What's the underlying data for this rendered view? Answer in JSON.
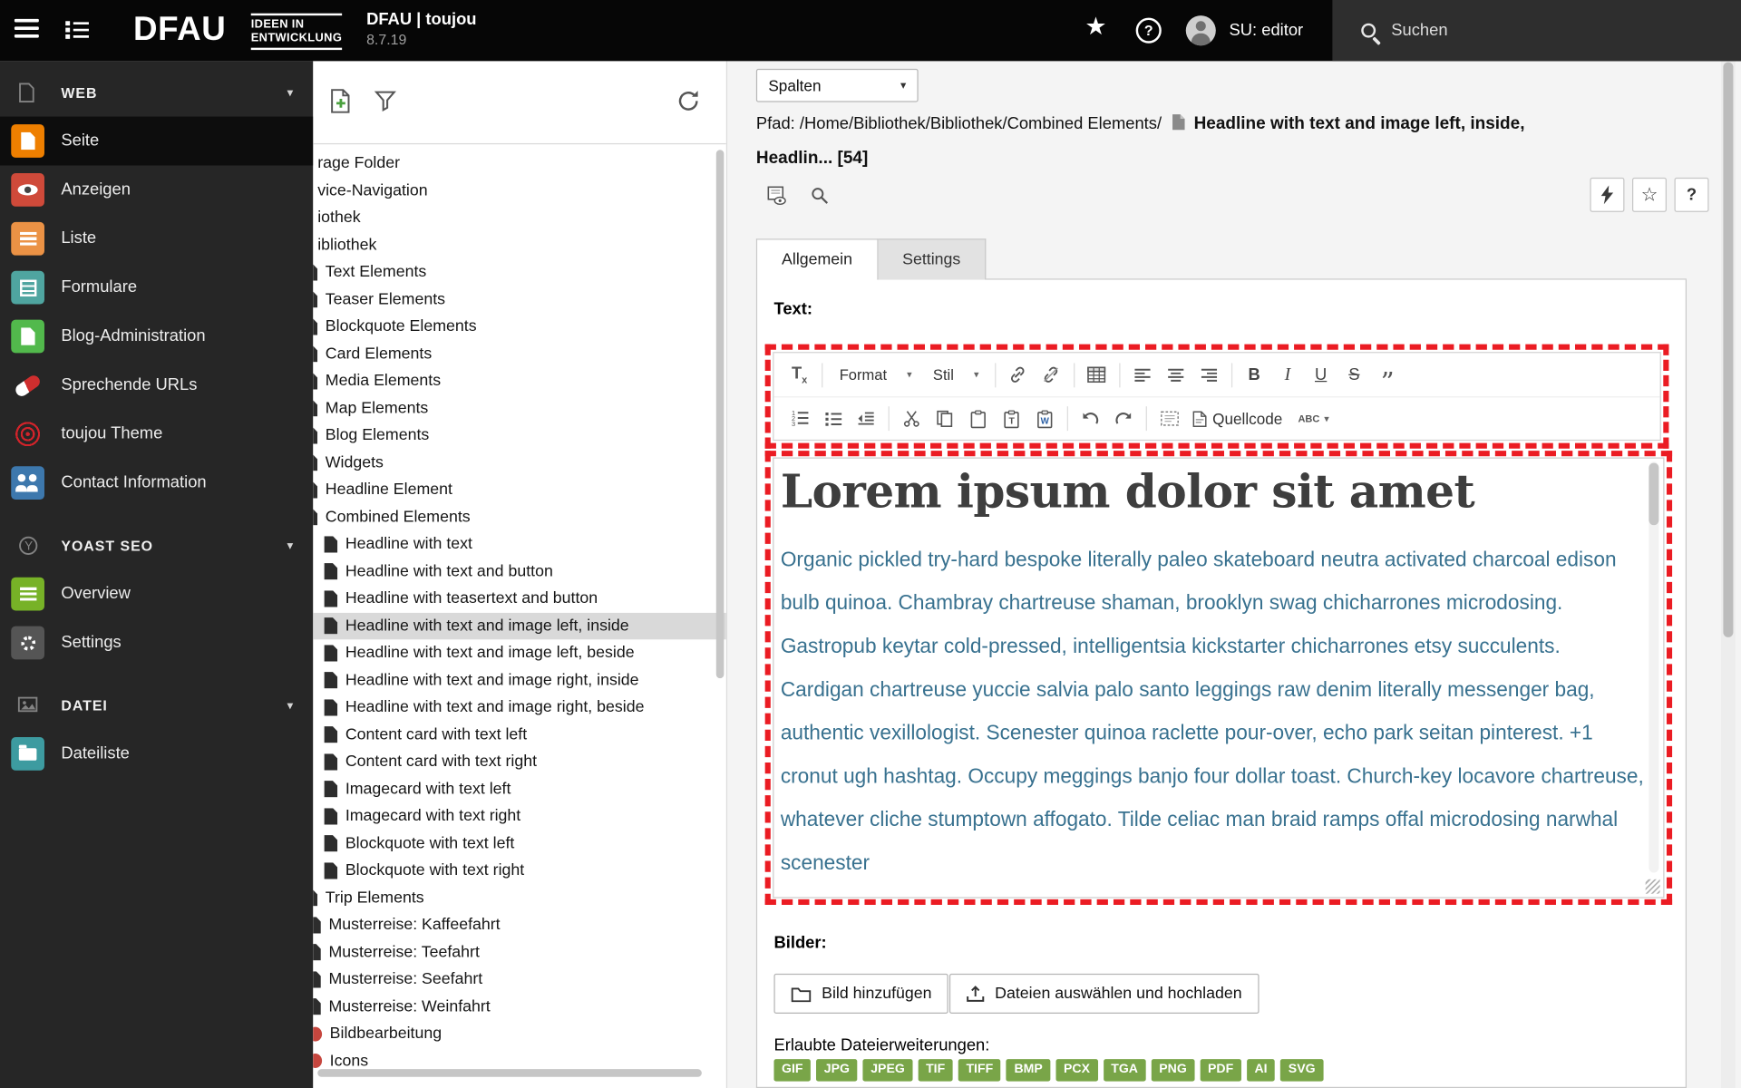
{
  "topbar": {
    "logo": {
      "brand": "DFAU",
      "claim_line1": "IDEEN IN",
      "claim_line2": "ENTWICKLUNG"
    },
    "site": {
      "title": "DFAU | toujou",
      "version": "8.7.19"
    },
    "user_label": "SU: editor",
    "search_label": "Suchen"
  },
  "icons": {
    "caret": "▾",
    "star": "★",
    "star_outline": "☆",
    "question": "?",
    "bold": "B",
    "italic": "I",
    "underline": "U",
    "strike": "S",
    "quote": "”",
    "remove_format_t": "T",
    "remove_format_x": "x"
  },
  "sidebar": {
    "web": {
      "label": "WEB",
      "items": [
        {
          "name": "sidebar-item-seite",
          "label": "Seite",
          "color": "#ee7f00",
          "cls": "seite active"
        },
        {
          "name": "sidebar-item-anzeigen",
          "label": "Anzeigen",
          "color": "#cf4a3a",
          "cls": "anzeigen"
        },
        {
          "name": "sidebar-item-liste",
          "label": "Liste",
          "color": "#eb9245",
          "cls": "liste"
        },
        {
          "name": "sidebar-item-formulare",
          "label": "Formulare",
          "color": "#4fa5a0",
          "cls": "formulare"
        },
        {
          "name": "sidebar-item-blog-administration",
          "label": "Blog-Administration",
          "color": "#52b94c",
          "cls": "blog"
        },
        {
          "name": "sidebar-item-sprechende-urls",
          "label": "Sprechende URLs",
          "color": "transparent",
          "cls": "urls"
        },
        {
          "name": "sidebar-item-toujou-theme",
          "label": "toujou Theme",
          "color": "transparent",
          "cls": "theme"
        },
        {
          "name": "sidebar-item-contact-information",
          "label": "Contact Information",
          "color": "#3d78ad",
          "cls": "contact"
        }
      ]
    },
    "yoast": {
      "label": "YOAST SEO",
      "items": [
        {
          "name": "sidebar-item-overview",
          "label": "Overview",
          "color": "#77b227",
          "cls": "overview"
        },
        {
          "name": "sidebar-item-settings",
          "label": "Settings",
          "color": "#555555",
          "cls": "gear"
        }
      ]
    },
    "datei": {
      "label": "DATEI",
      "items": [
        {
          "name": "sidebar-item-dateiliste",
          "label": "Dateiliste",
          "color": "#3d9ba0",
          "cls": "folder"
        }
      ]
    }
  },
  "tree": {
    "items": [
      {
        "label": "rage Folder",
        "cls": "l0"
      },
      {
        "label": "vice-Navigation",
        "cls": "l0"
      },
      {
        "label": "iothek",
        "cls": "l0"
      },
      {
        "label": "ibliothek",
        "cls": "l0"
      },
      {
        "label": "Text Elements",
        "cls": "l1"
      },
      {
        "label": "Teaser Elements",
        "cls": "l1"
      },
      {
        "label": "Blockquote Elements",
        "cls": "l1"
      },
      {
        "label": "Card Elements",
        "cls": "l1"
      },
      {
        "label": "Media Elements",
        "cls": "l1"
      },
      {
        "label": "Map Elements",
        "cls": "l1"
      },
      {
        "label": "Blog Elements",
        "cls": "l1"
      },
      {
        "label": "Widgets",
        "cls": "l1"
      },
      {
        "label": "Headline Element",
        "cls": "l1"
      },
      {
        "label": "Combined Elements",
        "cls": "l1"
      },
      {
        "label": "Headline with text",
        "cls": "l2"
      },
      {
        "label": "Headline with text and button",
        "cls": "l2"
      },
      {
        "label": "Headline with teasertext and button",
        "cls": "l2"
      },
      {
        "label": "Headline with text and image left, inside",
        "cls": "l2 sel"
      },
      {
        "label": "Headline with text and image left, beside",
        "cls": "l2"
      },
      {
        "label": "Headline with text and image right, inside",
        "cls": "l2"
      },
      {
        "label": "Headline with text and image right, beside",
        "cls": "l2"
      },
      {
        "label": "Content card with text left",
        "cls": "l2"
      },
      {
        "label": "Content card with text right",
        "cls": "l2"
      },
      {
        "label": "Imagecard with text left",
        "cls": "l2"
      },
      {
        "label": "Imagecard with text right",
        "cls": "l2"
      },
      {
        "label": "Blockquote with text left",
        "cls": "l2"
      },
      {
        "label": "Blockquote with text right",
        "cls": "l2"
      },
      {
        "label": "Trip Elements",
        "cls": "l1"
      },
      {
        "label": "Musterreise: Kaffeefahrt",
        "cls": "l1b"
      },
      {
        "label": "Musterreise: Teefahrt",
        "cls": "l1b"
      },
      {
        "label": "Musterreise: Seefahrt",
        "cls": "l1b"
      },
      {
        "label": "Musterreise: Weinfahrt",
        "cls": "l1b"
      },
      {
        "label": "Bildbearbeitung",
        "cls": "l1r"
      },
      {
        "label": "Icons",
        "cls": "l1r"
      }
    ]
  },
  "docheader": {
    "columns_select_value": "Spalten",
    "path_label": "Pfad:",
    "path_value": "/Home/Bibliothek/Bibliothek/Combined Elements/",
    "record_title_part1": "Headline with text and image left, inside,",
    "record_title_part2": "Headlin... [54]"
  },
  "tabs": {
    "general": "Allgemein",
    "settings": "Settings"
  },
  "form": {
    "text_label": "Text:",
    "rte": {
      "format_label": "Format",
      "style_label": "Stil",
      "source_label": "Quellcode",
      "spell_label": "ABC",
      "heading": "Lorem ipsum dolor sit amet",
      "paragraph": "Organic pickled try-hard bespoke literally paleo skateboard neutra activated charcoal edison bulb quinoa. Chambray chartreuse shaman, brooklyn swag chicharrones microdosing. Gastropub keytar cold-pressed, intelligentsia kickstarter chicharrones etsy succulents. Cardigan chartreuse yuccie salvia palo santo leggings raw denim literally messenger bag, authentic vexillologist. Scenester quinoa raclette pour-over, echo park seitan pinterest. +1 cronut ugh hashtag. Occupy meggings banjo four dollar toast. Church-key locavore chartreuse, whatever cliche stumptown affogato. Tilde celiac man braid ramps offal microdosing narwhal scenester"
    },
    "images_label": "Bilder:",
    "add_image_button": "Bild hinzufügen",
    "upload_button": "Dateien auswählen und hochladen",
    "extensions_label": "Erlaubte Dateierweiterungen:",
    "extensions": [
      "GIF",
      "JPG",
      "JPEG",
      "TIF",
      "TIFF",
      "BMP",
      "PCX",
      "TGA",
      "PNG",
      "PDF",
      "AI",
      "SVG"
    ]
  },
  "colors": {
    "annotation_red": "#eb1c23",
    "badge_green": "#79a548",
    "selected_tree_row": "#d9d9d9"
  }
}
